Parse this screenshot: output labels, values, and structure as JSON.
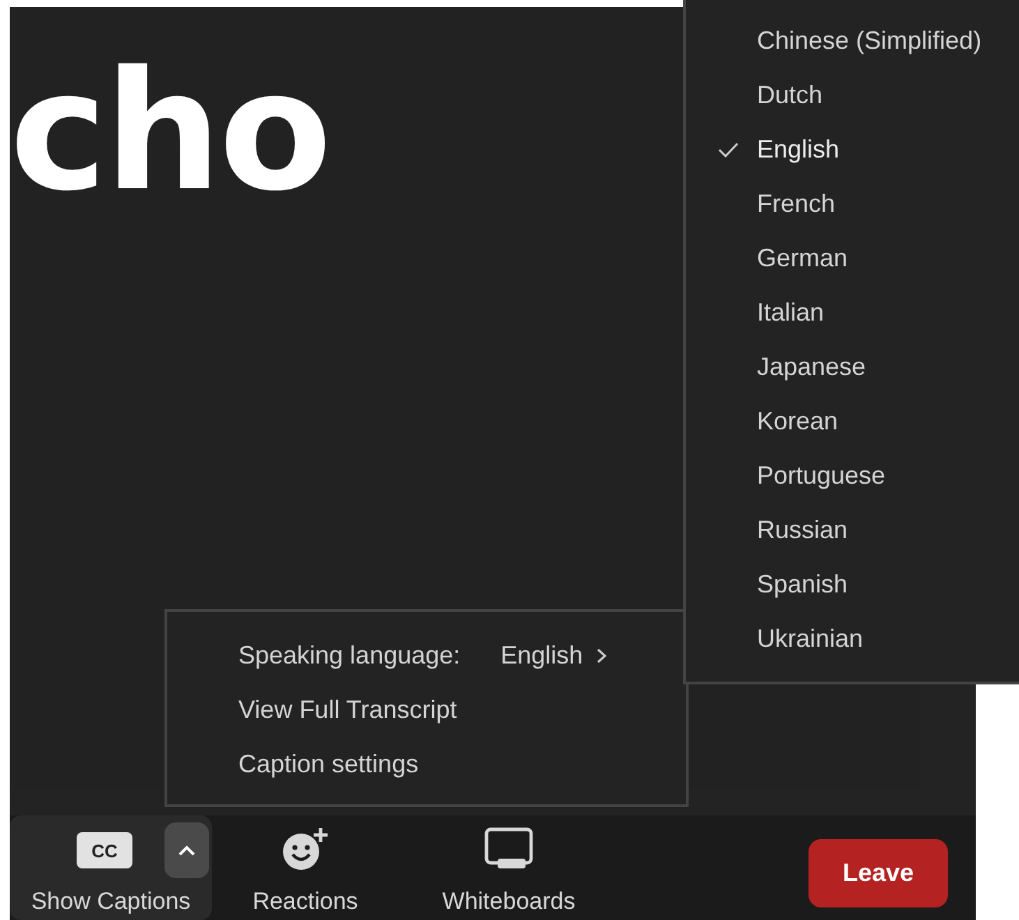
{
  "video": {
    "caption_text": "cho"
  },
  "caption_menu": {
    "items": [
      {
        "kind": "submenu",
        "label": "Speaking language:",
        "value": "English"
      },
      {
        "kind": "plain",
        "label": "View Full Transcript"
      },
      {
        "kind": "plain",
        "label": "Caption settings"
      }
    ]
  },
  "language_menu": {
    "items": [
      {
        "label": "Chinese (Simplified)",
        "selected": false
      },
      {
        "label": "Dutch",
        "selected": false
      },
      {
        "label": "English",
        "selected": true
      },
      {
        "label": "French",
        "selected": false
      },
      {
        "label": "German",
        "selected": false
      },
      {
        "label": "Italian",
        "selected": false
      },
      {
        "label": "Japanese",
        "selected": false
      },
      {
        "label": "Korean",
        "selected": false
      },
      {
        "label": "Portuguese",
        "selected": false
      },
      {
        "label": "Russian",
        "selected": false
      },
      {
        "label": "Spanish",
        "selected": false
      },
      {
        "label": "Ukrainian",
        "selected": false
      }
    ]
  },
  "toolbar": {
    "buttons": [
      {
        "kind": "captions",
        "label": "Show Captions",
        "icon_text": "CC",
        "selected": true
      },
      {
        "kind": "reactions",
        "label": "Reactions",
        "selected": false
      },
      {
        "kind": "whiteboards",
        "label": "Whiteboards",
        "selected": false
      }
    ],
    "leave": "Leave"
  }
}
